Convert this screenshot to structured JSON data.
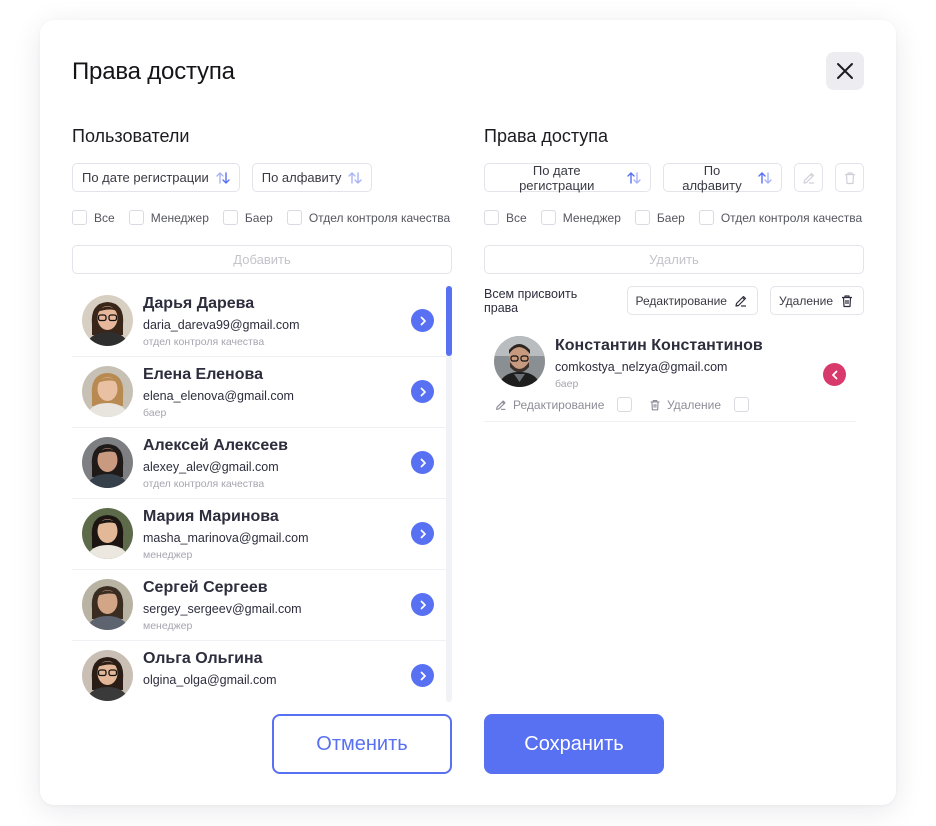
{
  "modal": {
    "title": "Права доступа",
    "cancel_label": "Отменить",
    "save_label": "Сохранить"
  },
  "users_panel": {
    "title": "Пользователи",
    "sort_by_date": "По дате регистрации",
    "sort_by_alpha": "По алфавиту",
    "filters": [
      "Все",
      "Менеджер",
      "Баер",
      "Отдел контроля качества"
    ],
    "add_label": "Добавить",
    "users": [
      {
        "name": "Дарья Дарева",
        "email": "daria_dareva99@gmail.com",
        "role": "отдел контроля качества",
        "avatar": "avatar-woman-glasses"
      },
      {
        "name": "Елена Еленова",
        "email": "elena_elenova@gmail.com",
        "role": "баер",
        "avatar": "avatar-woman-blonde"
      },
      {
        "name": "Алексей Алексеев",
        "email": "alexey_alev@gmail.com",
        "role": "отдел контроля качества",
        "avatar": "avatar-man-dark"
      },
      {
        "name": "Мария Маринова",
        "email": "masha_marinova@gmail.com",
        "role": "менеджер",
        "avatar": "avatar-woman-asian"
      },
      {
        "name": "Сергей Сергеев",
        "email": "sergey_sergeev@gmail.com",
        "role": "менеджер",
        "avatar": "avatar-man-beard"
      },
      {
        "name": "Ольга Ольгина",
        "email": "olgina_olga@gmail.com",
        "role": "",
        "avatar": "avatar-woman-glasses-2"
      }
    ]
  },
  "access_panel": {
    "title": "Права доступа",
    "sort_by_date": "По дате регистрации",
    "sort_by_alpha": "По алфавиту",
    "filters": [
      "Все",
      "Менеджер",
      "Баер",
      "Отдел контроля качества"
    ],
    "delete_label": "Удалить",
    "assign_all_label": "Всем присвоить права",
    "edit_label": "Редактирование",
    "remove_label": "Удаление",
    "granted": {
      "name": "Константин Константинов",
      "email": "comkostya_nelzya@gmail.com",
      "role": "баер",
      "edit_perm": "Редактирование",
      "delete_perm": "Удаление",
      "avatar": "avatar-man-glasses"
    }
  },
  "colors": {
    "accent": "#5870f2",
    "danger": "#d83a6b",
    "muted": "#a5a5b0"
  }
}
